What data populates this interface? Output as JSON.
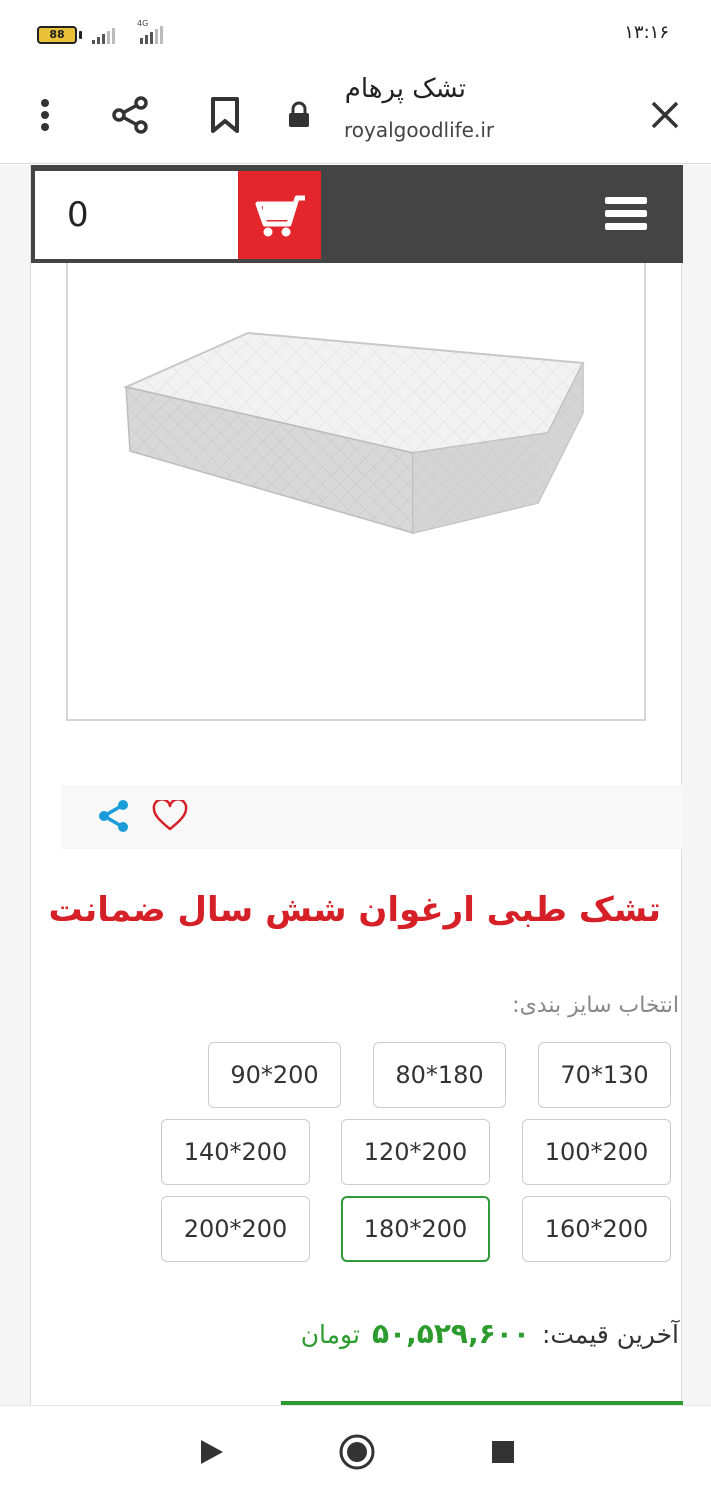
{
  "status_bar": {
    "battery": "88",
    "network": "4G",
    "time": "۱۳:۱۶"
  },
  "browser": {
    "page_title": "تشک پرهام",
    "url": "royalgoodlife.ir",
    "icons": [
      "close-icon",
      "lock-icon",
      "bookmark-icon",
      "share-icon",
      "more-vert-icon"
    ]
  },
  "site_header": {
    "cart_count": "0",
    "cart_color": "#e2262b",
    "header_color": "#444444"
  },
  "product": {
    "title": "تشک طبی ارغوان شش سال ضمانت",
    "title_color": "#d62027",
    "size_label": "انتخاب سایز بندی:",
    "sizes": [
      "70*130",
      "80*180",
      "90*200",
      "100*200",
      "120*200",
      "140*200",
      "160*200",
      "180*200",
      "200*200"
    ],
    "selected_size": "180*200",
    "price_label": "آخرین قیمت:",
    "price_value": "۵۰,۵۲۹,۶۰۰",
    "price_unit": "تومان",
    "price_color": "#2c9b2e"
  },
  "nav_bar": {
    "icons": [
      "back-play-icon",
      "home-icon",
      "recents-icon"
    ]
  }
}
